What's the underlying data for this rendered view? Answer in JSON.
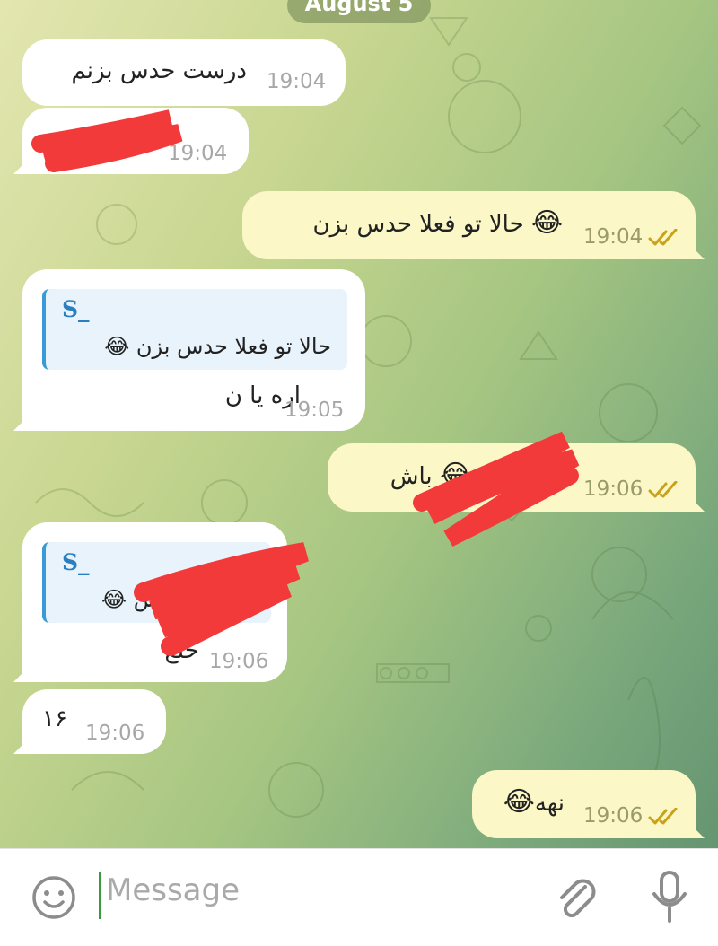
{
  "date_label": "August 5",
  "messages": [
    {
      "direction": "in",
      "text": "درست حدس بزنم",
      "time": "19:04"
    },
    {
      "direction": "in",
      "text": "",
      "time": "19:04",
      "redacted": true
    },
    {
      "direction": "out",
      "text": "حالا تو فعلا حدس بزن",
      "emoji": "😂",
      "time": "19:04",
      "read": true
    },
    {
      "direction": "in",
      "reply_name": "S_",
      "reply_text": "حالا تو فعلا حدس بزن",
      "reply_emoji": "😂",
      "text": "اره یا ن",
      "time": "19:05"
    },
    {
      "direction": "out",
      "text": "باش",
      "emoji": "😂",
      "time": "19:06",
      "read": true,
      "redacted": true
    },
    {
      "direction": "in",
      "reply_name": "S_",
      "reply_text": "باش",
      "reply_emoji": "😂",
      "text": "حلع",
      "time": "19:06",
      "redacted": true
    },
    {
      "direction": "in",
      "text": "۱۶",
      "time": "19:06"
    },
    {
      "direction": "out",
      "text": "نهه",
      "emoji": "😂",
      "time": "19:06",
      "read": true
    }
  ],
  "composer": {
    "placeholder": "Message",
    "emoji_icon": "smile-icon",
    "attach_icon": "paperclip-icon",
    "mic_icon": "microphone-icon"
  },
  "colors": {
    "incoming_bubble": "#ffffff",
    "outgoing_bubble": "#fbf7c6",
    "reply_accent": "#3a9ad9",
    "read_ticks": "#c8a21a",
    "redaction": "#f23a3a",
    "caret": "#3b9a3b"
  }
}
